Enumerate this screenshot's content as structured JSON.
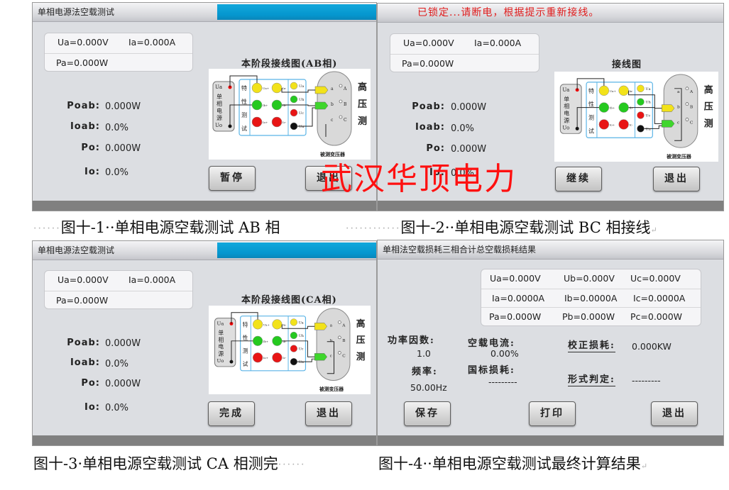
{
  "panels": [
    {
      "id": "fig1",
      "title": "单相电源法空载测试",
      "title_warning": false,
      "has_progress": true,
      "measure": {
        "ua": "Ua=0.000V",
        "ia": "Ia=0.000A",
        "pa": "Pa=0.000W"
      },
      "stats": [
        {
          "label": "Poab:",
          "value": "0.000W"
        },
        {
          "label": "Ioab:",
          "value": "0.0%"
        },
        {
          "label": "Po:",
          "value": "0.000W"
        },
        {
          "label": "Io:",
          "value": "0.0%"
        }
      ],
      "diagram_title": "本阶段接线图(AB相)",
      "wiring": "AB",
      "buttons": [
        "暂停",
        "退出"
      ]
    },
    {
      "id": "fig2",
      "title": "已锁定...请断电，根据提示重新接线。",
      "title_warning": true,
      "has_progress": false,
      "measure": {
        "ua": "Ua=0.000V",
        "ia": "Ia=0.000A",
        "pa": "Pa=0.000W"
      },
      "stats": [
        {
          "label": "Poab:",
          "value": "0.000W"
        },
        {
          "label": "Ioab:",
          "value": "0.0%"
        },
        {
          "label": "Po:",
          "value": "0.000W"
        },
        {
          "label": "Io:",
          "value": "0.0%"
        }
      ],
      "diagram_title": "接线图",
      "wiring": "BC",
      "buttons": [
        "继续",
        "退出"
      ]
    },
    {
      "id": "fig3",
      "title": "单相电源法空载测试",
      "title_warning": false,
      "has_progress": true,
      "measure": {
        "ua": "Ua=0.000V",
        "ia": "Ia=0.000A",
        "pa": "Pa=0.000W"
      },
      "stats": [
        {
          "label": "Poab:",
          "value": "0.000W"
        },
        {
          "label": "Ioab:",
          "value": "0.0%"
        },
        {
          "label": "Po:",
          "value": "0.000W"
        },
        {
          "label": "Io:",
          "value": "0.0%"
        }
      ],
      "diagram_title": "本阶段接线图(CA相)",
      "wiring": "CA",
      "buttons": [
        "完成",
        "退出"
      ]
    }
  ],
  "diagram_labels": {
    "source": [
      "Ua",
      "单",
      "相",
      "电",
      "源",
      "Uo"
    ],
    "test_col": [
      "特",
      "性",
      "测",
      "试"
    ],
    "terminals_left": [
      "Ua+",
      "Ib+",
      "Io+"
    ],
    "terminals_mid": [
      "Ia-",
      "Ib-",
      "Ic-"
    ],
    "terminals_right": [
      "Ua",
      "Uh",
      "Uc",
      "Un"
    ],
    "low_side": [
      "a",
      "b",
      "c",
      "0"
    ],
    "high_side": [
      "A",
      "B",
      "C"
    ],
    "high_voltage": [
      "高",
      "压",
      "测"
    ],
    "transformer": "被测变压器"
  },
  "result_panel": {
    "title": "单相法空载损耗三相合计总空载损耗结果",
    "grid": [
      [
        "Ua=0.000V",
        "Ub=0.000V",
        "Uc=0.000V"
      ],
      [
        "Ia=0.0000A",
        "Ib=0.0000A",
        "Ic=0.0000A"
      ],
      [
        "Pa=0.000W",
        "Pb=0.000W",
        "Pc=0.000W"
      ]
    ],
    "power_factor_label": "功率因数:",
    "power_factor": "1.0",
    "frequency_label": "频率:",
    "frequency": "50.00Hz",
    "noload_current_label": "空载电流:",
    "noload_current": "0.00%",
    "std_loss_label": "国标损耗:",
    "std_loss": "---------",
    "corrected_loss_label": "校正损耗:",
    "corrected_loss": "0.000KW",
    "verdict_label": "形式判定:",
    "verdict": "---------",
    "buttons": {
      "save": "保存",
      "print": "打印",
      "exit": "退出"
    }
  },
  "captions": {
    "fig1": "图十-1··单相电源空载测试 AB 相",
    "fig2": "图十-2··单相电源空载测试 BC 相接线",
    "fig3": "图十-3·单相电源空载测试 CA 相测完",
    "fig4": "图十-4··单相电源空载测试最终计算结果",
    "leader_dots": "······",
    "paragraph_mark": "↵"
  },
  "watermark": "武汉华顶电力"
}
